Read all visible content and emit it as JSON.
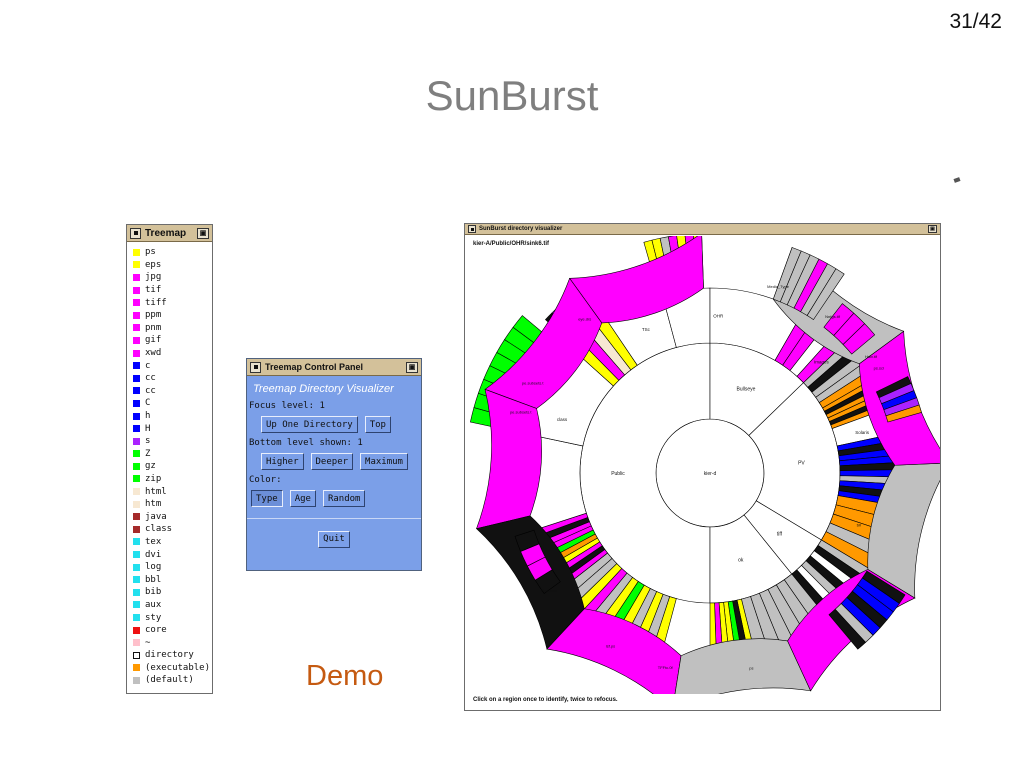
{
  "slide": {
    "page_number": "31/42",
    "title": "SunBurst",
    "demo_label": "Demo"
  },
  "legend": {
    "title": "Treemap",
    "items": [
      {
        "label": "ps",
        "color": "#ffff00"
      },
      {
        "label": "eps",
        "color": "#ffff00"
      },
      {
        "label": "jpg",
        "color": "#ff00ff"
      },
      {
        "label": "tif",
        "color": "#ff00ff"
      },
      {
        "label": "tiff",
        "color": "#ff00ff"
      },
      {
        "label": "ppm",
        "color": "#ff00ff"
      },
      {
        "label": "pnm",
        "color": "#ff00ff"
      },
      {
        "label": "gif",
        "color": "#ff00ff"
      },
      {
        "label": "xwd",
        "color": "#ff00ff"
      },
      {
        "label": "c",
        "color": "#0000ff"
      },
      {
        "label": "cc",
        "color": "#0000ff"
      },
      {
        "label": "cc",
        "color": "#0000ff"
      },
      {
        "label": "C",
        "color": "#0000ff"
      },
      {
        "label": "h",
        "color": "#0000ff"
      },
      {
        "label": "H",
        "color": "#0000ff"
      },
      {
        "label": "s",
        "color": "#aa22ff"
      },
      {
        "label": "Z",
        "color": "#00ff00"
      },
      {
        "label": "gz",
        "color": "#00ff00"
      },
      {
        "label": "zip",
        "color": "#00ff00"
      },
      {
        "label": "html",
        "color": "#f7e8d2"
      },
      {
        "label": "htm",
        "color": "#f7e8d2"
      },
      {
        "label": "java",
        "color": "#a52a2a"
      },
      {
        "label": "class",
        "color": "#a52a2a"
      },
      {
        "label": "tex",
        "color": "#22e0ee"
      },
      {
        "label": "dvi",
        "color": "#22e0ee"
      },
      {
        "label": "log",
        "color": "#22e0ee"
      },
      {
        "label": "bbl",
        "color": "#22e0ee"
      },
      {
        "label": "bib",
        "color": "#22e0ee"
      },
      {
        "label": "aux",
        "color": "#22e0ee"
      },
      {
        "label": "sty",
        "color": "#22e0ee"
      },
      {
        "label": "core",
        "color": "#ee1111"
      },
      {
        "label": "~",
        "color": "#ffc0cb"
      },
      {
        "label": "directory",
        "color": "#ffffff"
      },
      {
        "label": "(executable)",
        "color": "#ff9900"
      },
      {
        "label": "(default)",
        "color": "#c0c0c0"
      }
    ]
  },
  "control_panel": {
    "title": "Treemap Control Panel",
    "heading": "Treemap Directory Visualizer",
    "focus_level": "Focus level:  1",
    "up_one_directory": "Up One Directory",
    "top": "Top",
    "bottom_level": "Bottom level shown:  1",
    "higher": "Higher",
    "deeper": "Deeper",
    "maximum": "Maximum",
    "color_label": "Color:",
    "type": "Type",
    "age": "Age",
    "random": "Random",
    "quit": "Quit"
  },
  "sunburst": {
    "title": "SunBurst directory visualizer",
    "path": "kier-A/Public/OHR/sink6.tif",
    "footer": "Click on a region once to identify, twice to refocus.",
    "center_label": "kier-d",
    "colors": {
      "outline": "#000000",
      "directory": "#ffffff",
      "default": "#c0c0c0",
      "image": "#ff00ff",
      "ps": "#ffff00",
      "code": "#0000ff",
      "archive": "#00ff00",
      "exec": "#ff9900",
      "asm": "#aa22ff",
      "html": "#f7e8d2",
      "dark": "#111111"
    },
    "ring1": [
      {
        "label": "Public",
        "start": 180,
        "end": 360
      },
      {
        "label": "Bullseye",
        "start": 0,
        "end": 46
      },
      {
        "label": "PV",
        "start": 46,
        "end": 121
      },
      {
        "label": "tiff",
        "start": 121,
        "end": 141
      },
      {
        "label": "ok",
        "start": 141,
        "end": 180
      }
    ],
    "ring2_labels": [
      {
        "label": "class",
        "angle": 290
      },
      {
        "label": "TSc",
        "angle": 336
      },
      {
        "label": "OHR",
        "angle": 3
      },
      {
        "label": "Images",
        "angle": 45
      },
      {
        "label": "Solaris",
        "angle": 75
      },
      {
        "label": "sv",
        "angle": 109
      },
      {
        "label": "tiff",
        "angle": 131
      }
    ],
    "outer_labels": [
      {
        "label": "pe.subsets.t",
        "angle": 297
      },
      {
        "label": "pe.subsets.t",
        "angle": 288
      },
      {
        "label": "eye.drs",
        "angle": 321
      },
      {
        "label": "Media_Type",
        "angle": 20
      },
      {
        "label": "Nnfgs.tif",
        "angle": 38
      },
      {
        "label": "Hdiv.tif",
        "angle": 54
      },
      {
        "label": "ps.scl",
        "angle": 58
      },
      {
        "label": "PhdLin-rf",
        "angle": 234
      },
      {
        "label": "lsf.ps",
        "angle": 210
      },
      {
        "label": "TFFtc.0f",
        "angle": 193
      },
      {
        "label": "ps",
        "angle": 168
      }
    ]
  }
}
